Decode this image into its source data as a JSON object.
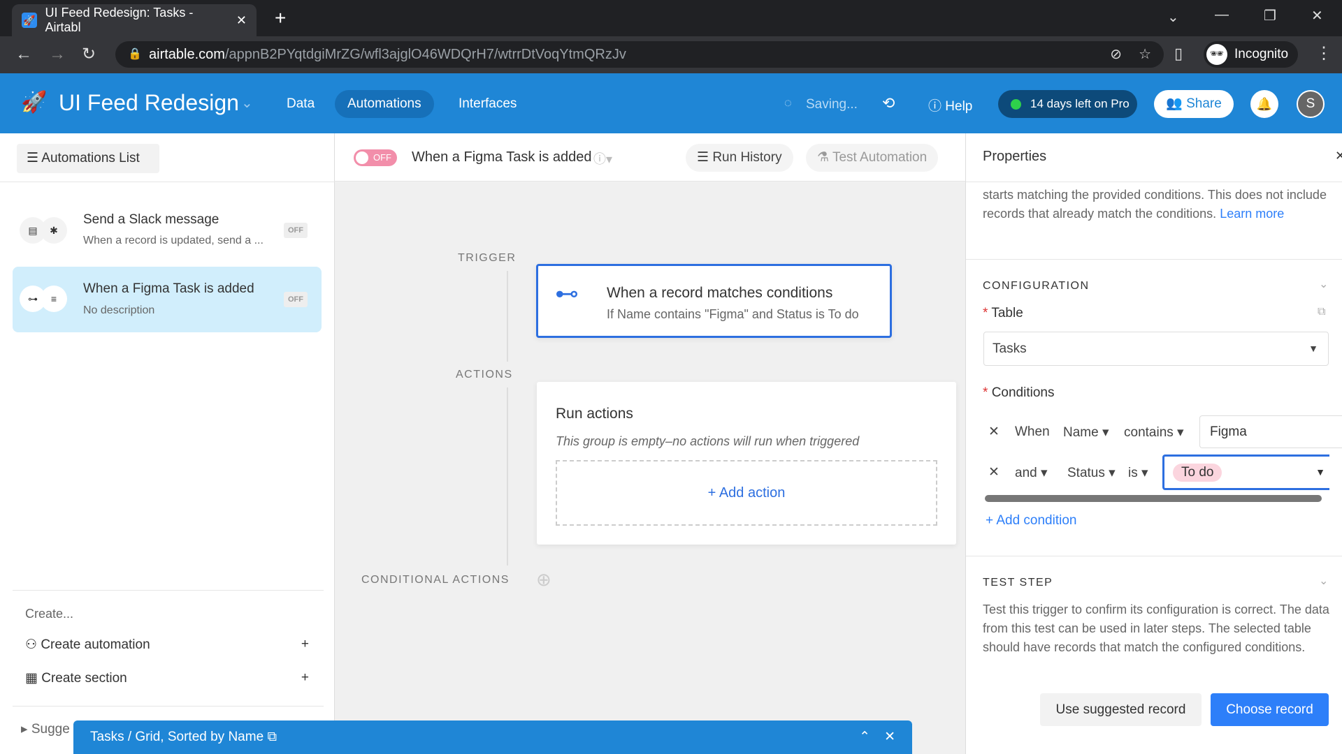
{
  "browser": {
    "tab_title": "UI Feed Redesign: Tasks - Airtabl",
    "url_host": "airtable.com",
    "url_path": "/appnB2PYqtdgiMrZG/wfl3ajglO46WDQrH7/wtrrDtVoqYtmQRzJv",
    "profile": "Incognito"
  },
  "header": {
    "base_name": "UI Feed Redesign",
    "nav": [
      "Data",
      "Automations",
      "Interfaces"
    ],
    "active_nav": "Automations",
    "saving": "Saving...",
    "help": "Help",
    "trial": "14 days left on Pro",
    "share": "Share",
    "avatar": "S",
    "accent": "#1f86d6"
  },
  "toolbar": {
    "list_button": "Automations List",
    "toggle": "OFF",
    "automation_name": "When a Figma Task is added",
    "run_history": "Run History",
    "test_automation": "Test Automation"
  },
  "sidebar": {
    "items": [
      {
        "title": "Send a Slack message",
        "desc": "When a record is updated, send a ...",
        "status": "OFF"
      },
      {
        "title": "When a Figma Task is added",
        "desc": "No description",
        "status": "OFF",
        "selected": true
      }
    ],
    "create_label": "Create...",
    "create_automation": "Create automation",
    "create_section": "Create section",
    "suggestions": "Sugge"
  },
  "canvas": {
    "trigger_label": "TRIGGER",
    "actions_label": "ACTIONS",
    "conditional_label": "CONDITIONAL ACTIONS",
    "trigger_title": "When a record matches conditions",
    "trigger_desc": "If Name contains \"Figma\" and Status is To do",
    "run_actions_title": "Run actions",
    "run_actions_empty": "This group is empty–no actions will run when triggered",
    "add_action": "Add action"
  },
  "properties": {
    "title": "Properties",
    "intro": "starts matching the provided conditions. This does not include records that already match the conditions.",
    "learn_more": "Learn more",
    "configuration": "CONFIGURATION",
    "table_label": "Table",
    "table_value": "Tasks",
    "conditions_label": "Conditions",
    "conditions": [
      {
        "conj": "When",
        "field": "Name",
        "op": "contains",
        "value": "Figma"
      },
      {
        "conj": "and",
        "field": "Status",
        "op": "is",
        "value": "To do"
      }
    ],
    "add_condition": "Add condition",
    "test_step": "TEST STEP",
    "test_text": "Test this trigger to confirm its configuration is correct. The data from this test can be used in later steps. The selected table should have records that match the configured conditions.",
    "use_suggested": "Use suggested record",
    "choose_record": "Choose record"
  },
  "bottom_bar": {
    "title": "Tasks / Grid, Sorted by Name"
  }
}
